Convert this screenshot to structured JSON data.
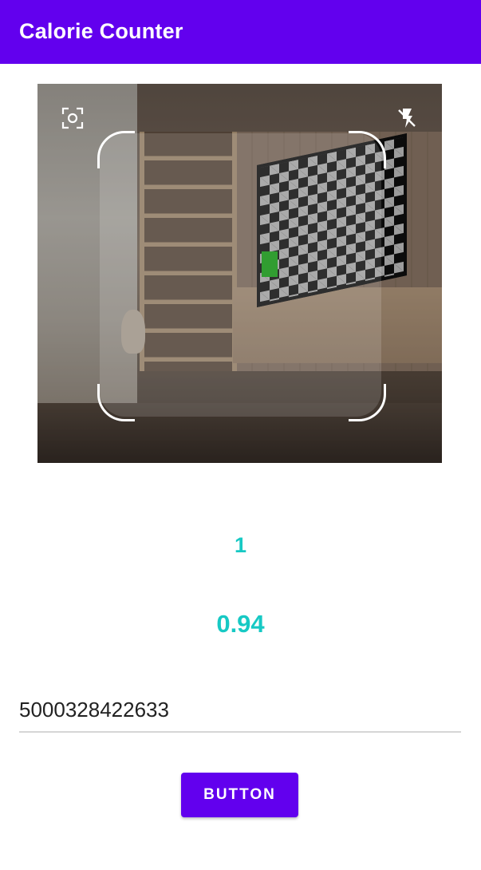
{
  "app_bar": {
    "title": "Calorie Counter"
  },
  "scanner": {
    "focus_icon": "focus-scan-icon",
    "flash_icon": "flash-off-icon"
  },
  "results": {
    "count": "1",
    "confidence": "0.94"
  },
  "barcode_input": {
    "value": "5000328422633"
  },
  "action_button": {
    "label": "BUTTON"
  },
  "colors": {
    "primary": "#6200ee",
    "accent_text": "#17c9c4",
    "underline": "#d6d6d6"
  }
}
